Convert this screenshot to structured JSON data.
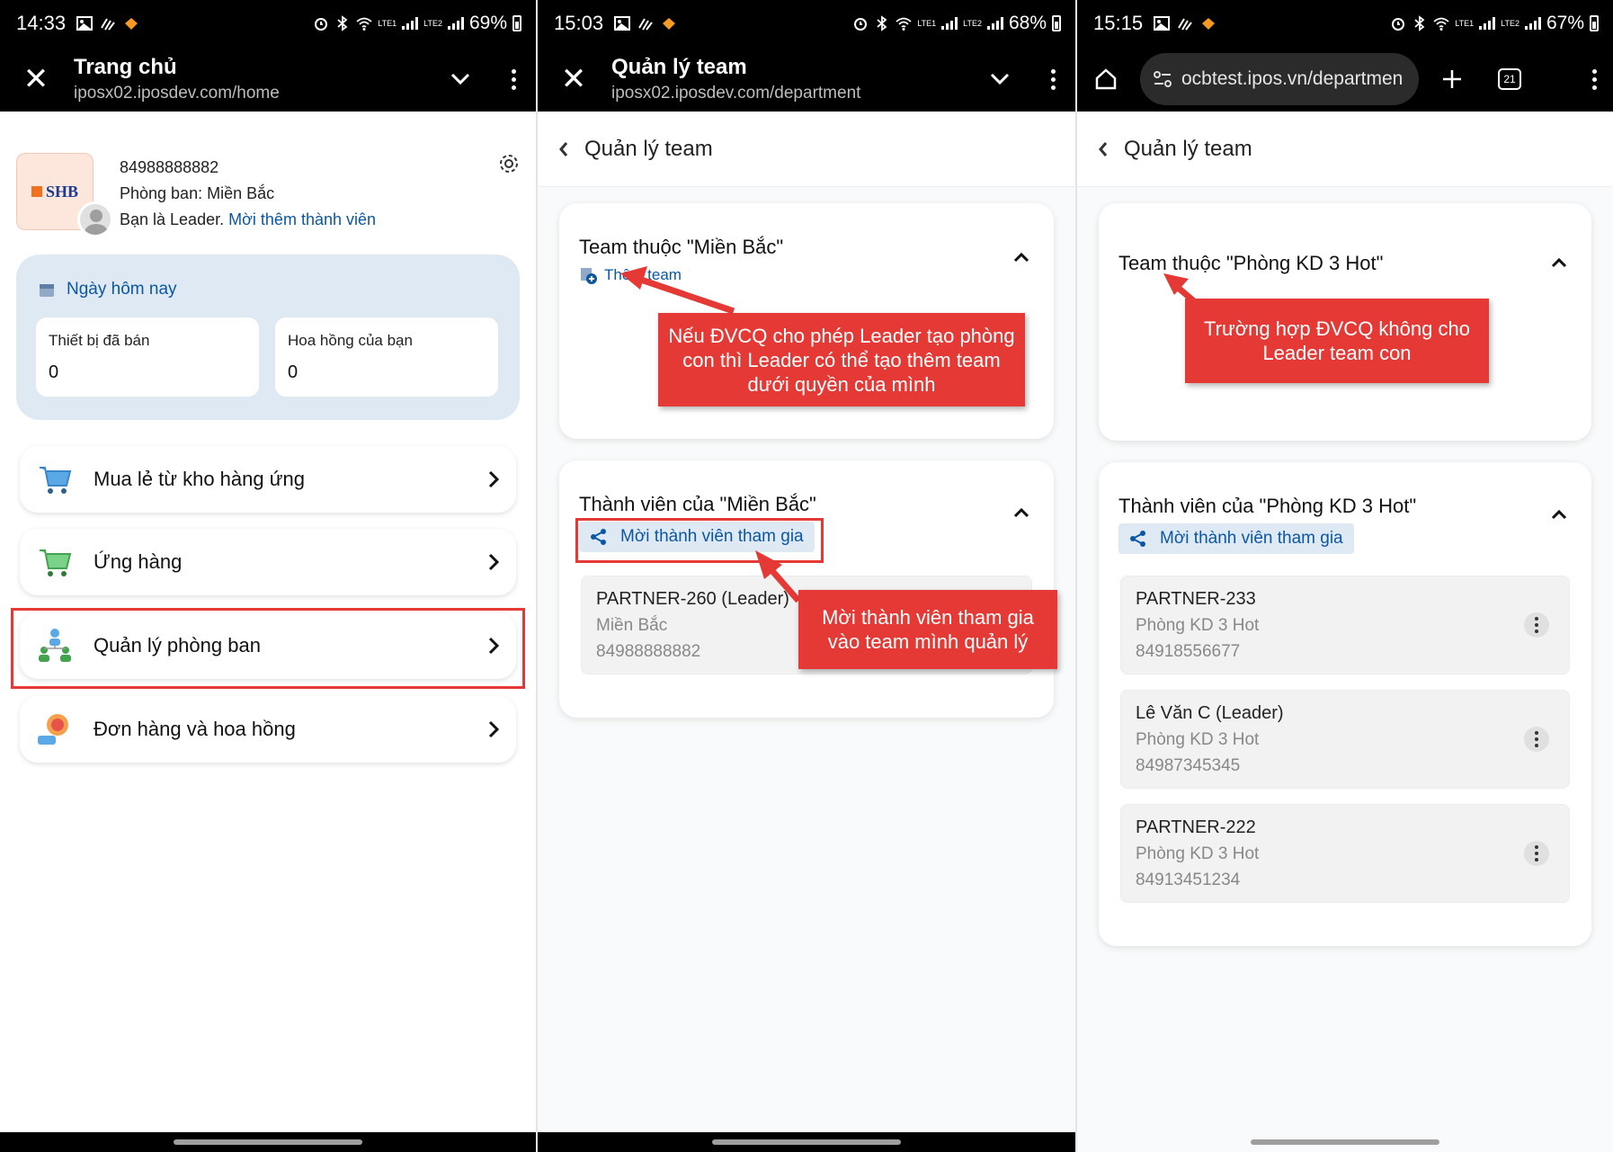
{
  "screen1": {
    "status": {
      "time": "14:33",
      "battery": "69%",
      "lte1": "LTE1",
      "lte2": "LTE2"
    },
    "appbar": {
      "title": "Trang chủ",
      "url": "iposx02.iposdev.com/home"
    },
    "profile": {
      "logo_text": "SHB",
      "phone": "84988888882",
      "department": "Phòng ban: Miền Bắc",
      "role_text": "Bạn là Leader.",
      "invite_link": "Mời thêm thành viên"
    },
    "today": {
      "header": "Ngày hôm nay",
      "stats": [
        {
          "label": "Thiết bị đã bán",
          "value": "0"
        },
        {
          "label": "Hoa hồng của bạn",
          "value": "0"
        }
      ]
    },
    "menu": [
      {
        "label": "Mua lẻ từ kho hàng ứng",
        "icon": "cart-icon"
      },
      {
        "label": "Ứng hàng",
        "icon": "cart-green-icon"
      },
      {
        "label": "Quản lý phòng ban",
        "icon": "team-structure-icon"
      },
      {
        "label": "Đơn hàng và hoa hồng",
        "icon": "commission-icon"
      }
    ]
  },
  "screen2": {
    "status": {
      "time": "15:03",
      "battery": "68%",
      "lte1": "LTE1",
      "lte2": "LTE2"
    },
    "appbar": {
      "title": "Quản lý team",
      "url": "iposx02.iposdev.com/department"
    },
    "page_title": "Quản lý team",
    "team_card": {
      "title": "Team thuộc \"Miền Bắc\"",
      "add_team": "Thêm team"
    },
    "members_card": {
      "title": "Thành viên của \"Miền Bắc\"",
      "invite": "Mời thành viên tham gia",
      "members": [
        {
          "name": "PARTNER-260 (Leader)",
          "dept": "Miền Bắc",
          "phone": "84988888882"
        }
      ]
    },
    "callouts": {
      "add_team": "Nếu ĐVCQ cho phép Leader tạo phòng con thì Leader có thể tạo thêm team dưới quyền của mình",
      "invite": "Mời thành viên tham gia vào team mình quản lý"
    }
  },
  "screen3": {
    "status": {
      "time": "15:15",
      "battery": "67%",
      "lte1": "LTE1",
      "lte2": "LTE2"
    },
    "browser": {
      "url": "ocbtest.ipos.vn/departmen",
      "tab_count": "21"
    },
    "page_title": "Quản lý team",
    "team_card": {
      "title": "Team thuộc \"Phòng KD 3 Hot\""
    },
    "members_card": {
      "title": "Thành viên của \"Phòng KD 3 Hot\"",
      "invite": "Mời thành viên tham gia",
      "members": [
        {
          "name": "PARTNER-233",
          "dept": "Phòng KD 3 Hot",
          "phone": "84918556677"
        },
        {
          "name": "Lê Văn C (Leader)",
          "dept": "Phòng KD 3 Hot",
          "phone": "84987345345"
        },
        {
          "name": "PARTNER-222",
          "dept": "Phòng KD 3 Hot",
          "phone": "84913451234"
        }
      ]
    },
    "callouts": {
      "no_subteam": "Trường hợp ĐVCQ không cho Leader team con"
    }
  },
  "colors": {
    "accent": "#0b57a4",
    "callout": "#e53935",
    "today_bg": "#dfe9f4"
  }
}
